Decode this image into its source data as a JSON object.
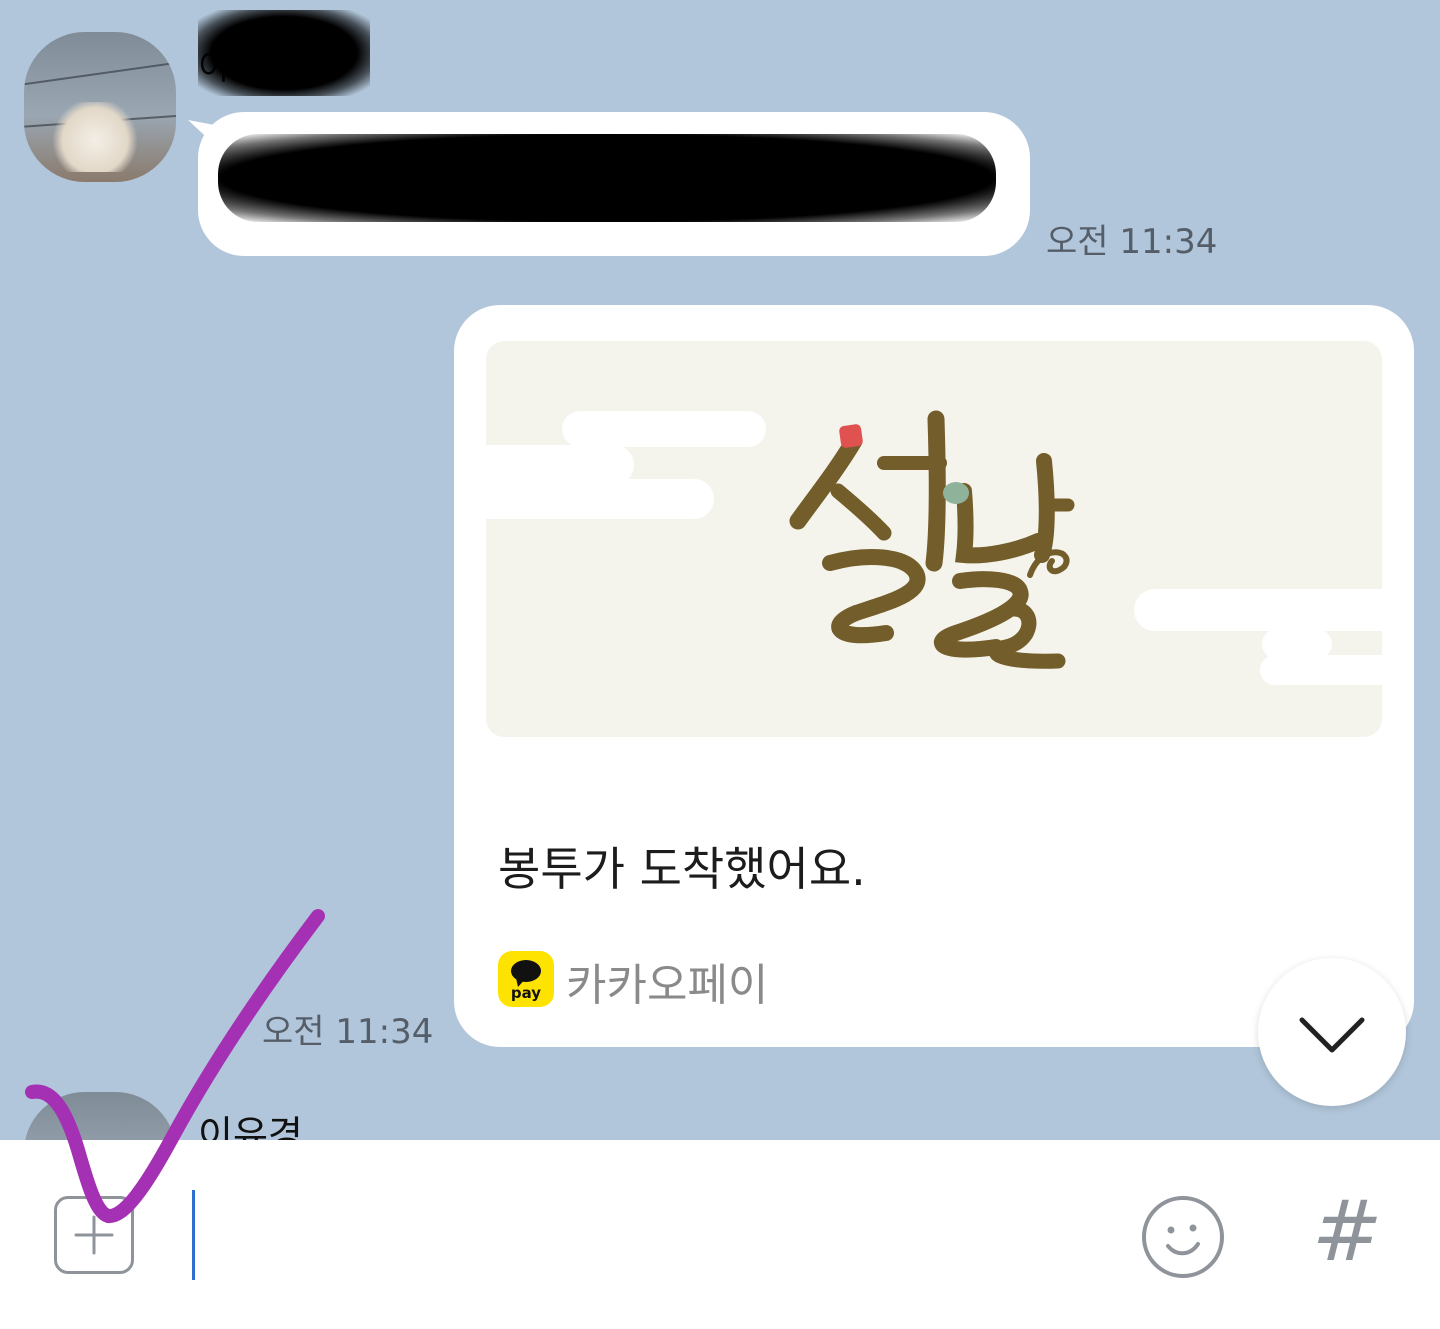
{
  "chat": {
    "incoming_message": {
      "sender_name_visible": "이",
      "sender_name_redacted": true,
      "message_redacted": true,
      "time": "오전 11:34"
    },
    "outgoing_card": {
      "image_title": "설날",
      "title": "봉투가 도착했어요.",
      "brand_icon_label": "pay",
      "brand": "카카오페이",
      "time": "오전 11:34"
    },
    "next_sender_name": "이유경",
    "scroll_down_icon": "chevron-down-icon"
  },
  "input_bar": {
    "plus_icon": "plus-icon",
    "input_value": "",
    "emoji_icon": "smiley-icon",
    "hash_label": "#"
  },
  "annotation": {
    "color": "#a431b3",
    "icon": "checkmark-annotation"
  },
  "colors": {
    "chat_background": "#b1c6da",
    "bubble": "#ffffff",
    "kakaopay_yellow": "#ffe300",
    "seollal_brown": "#735d2a",
    "seollal_red": "#e0524f",
    "seollal_green": "#8fb39a",
    "caret": "#2f6fd1"
  }
}
